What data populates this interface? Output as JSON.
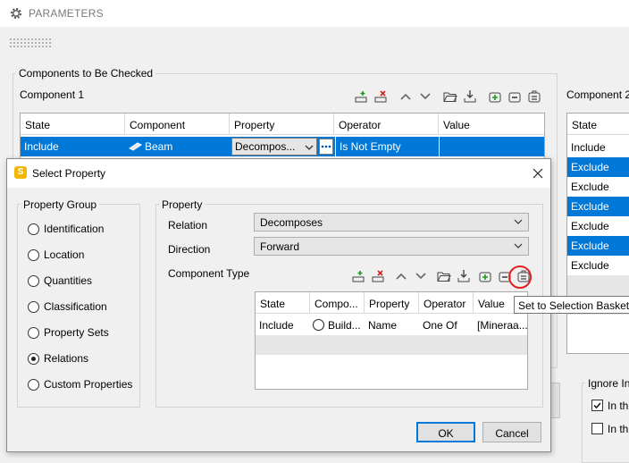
{
  "window": {
    "title": "PARAMETERS"
  },
  "components_group": {
    "title": "Components to Be Checked",
    "component1_label": "Component 1",
    "component2_label": "Component 2",
    "grid1": {
      "columns": [
        "State",
        "Component",
        "Property",
        "Operator",
        "Value"
      ],
      "row": {
        "state": "Include",
        "component": "Beam",
        "property": "Decompos...",
        "operator": "Is Not Empty",
        "value": ""
      }
    },
    "grid2": {
      "column": "State",
      "rows": [
        "Include",
        "Exclude",
        "Exclude",
        "Exclude",
        "Exclude",
        "Exclude",
        "Exclude"
      ]
    }
  },
  "ignore_group": {
    "title": "Ignore In",
    "option1": "In th",
    "option2": "In th"
  },
  "dialog": {
    "title": "Select Property",
    "property_group": {
      "title": "Property Group",
      "options": [
        "Identification",
        "Location",
        "Quantities",
        "Classification",
        "Property Sets",
        "Relations",
        "Custom Properties"
      ],
      "selected": "Relations"
    },
    "property": {
      "title": "Property",
      "relation_label": "Relation",
      "relation_value": "Decomposes",
      "direction_label": "Direction",
      "direction_value": "Forward",
      "component_type_label": "Component Type",
      "grid": {
        "columns": [
          "State",
          "Compo...",
          "Property",
          "Operator",
          "Value"
        ],
        "row": {
          "state": "Include",
          "component": "Build...",
          "property": "Name",
          "operator": "One Of",
          "value": "[Mineraa..."
        }
      }
    },
    "ok_label": "OK",
    "cancel_label": "Cancel",
    "tooltip": "Set to Selection Basket"
  },
  "colors": {
    "selection": "#0078d7",
    "exclude_row": "#0078d7",
    "highlight_circle": "#e02020"
  }
}
